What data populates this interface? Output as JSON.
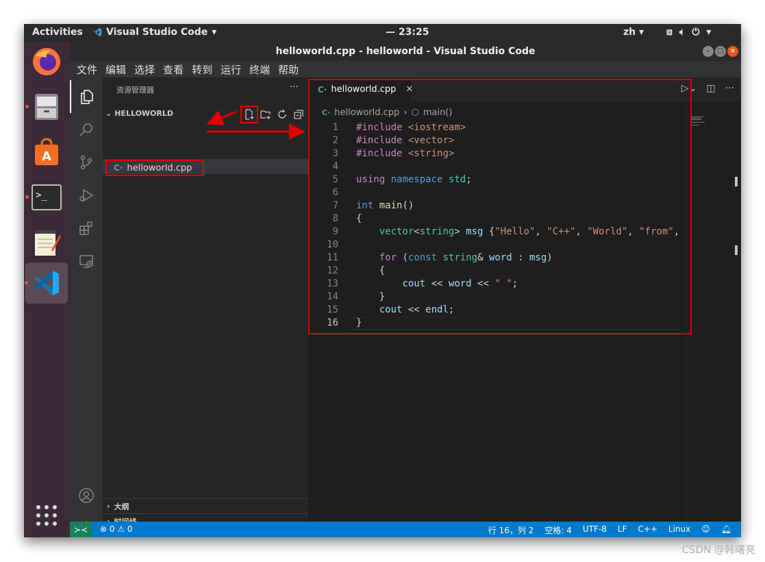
{
  "topbar": {
    "activities": "Activities",
    "app_name": "Visual Studio Code",
    "clock": "— 23:25",
    "lang": "zh"
  },
  "window": {
    "title": "helloworld.cpp - helloworld - Visual Studio Code"
  },
  "menu": [
    "文件",
    "编辑",
    "选择",
    "查看",
    "转到",
    "运行",
    "终端",
    "帮助"
  ],
  "sidebar": {
    "title": "资源管理器",
    "more": "···",
    "folder": "HELLOWORLD",
    "file": "helloworld.cpp",
    "sections": [
      "大纲",
      "时间线"
    ]
  },
  "editor": {
    "tab": "helloworld.cpp",
    "breadcrumb": [
      "helloworld.cpp",
      "main()"
    ],
    "current_line": 16,
    "line_numbers": [
      "1",
      "2",
      "3",
      "4",
      "5",
      "6",
      "7",
      "8",
      "9",
      "10",
      "11",
      "12",
      "13",
      "14",
      "15",
      "16"
    ]
  },
  "statusbar": {
    "problems": "⊗ 0 ⚠ 0",
    "position": "行 16，列 2",
    "spaces": "空格: 4",
    "encoding": "UTF-8",
    "eol": "LF",
    "language": "C++",
    "platform": "Linux"
  },
  "watermark": "CSDN @韩曙亮",
  "colors": {
    "accent": "#007acc",
    "highlight": "#e00000"
  }
}
